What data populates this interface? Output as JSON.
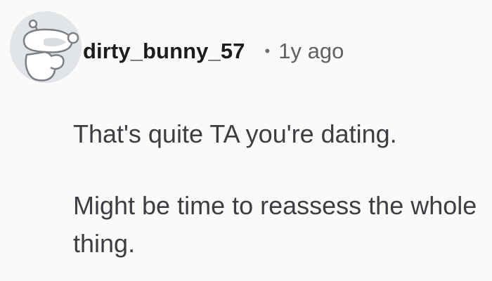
{
  "comment": {
    "username": "dirty_bunny_57",
    "separator": "•",
    "timestamp": "1y ago",
    "avatar_icon": "snoo-avatar-icon",
    "paragraphs": [
      "That's quite TA you're dating.",
      "Might be time to reassess the whole thing."
    ]
  }
}
